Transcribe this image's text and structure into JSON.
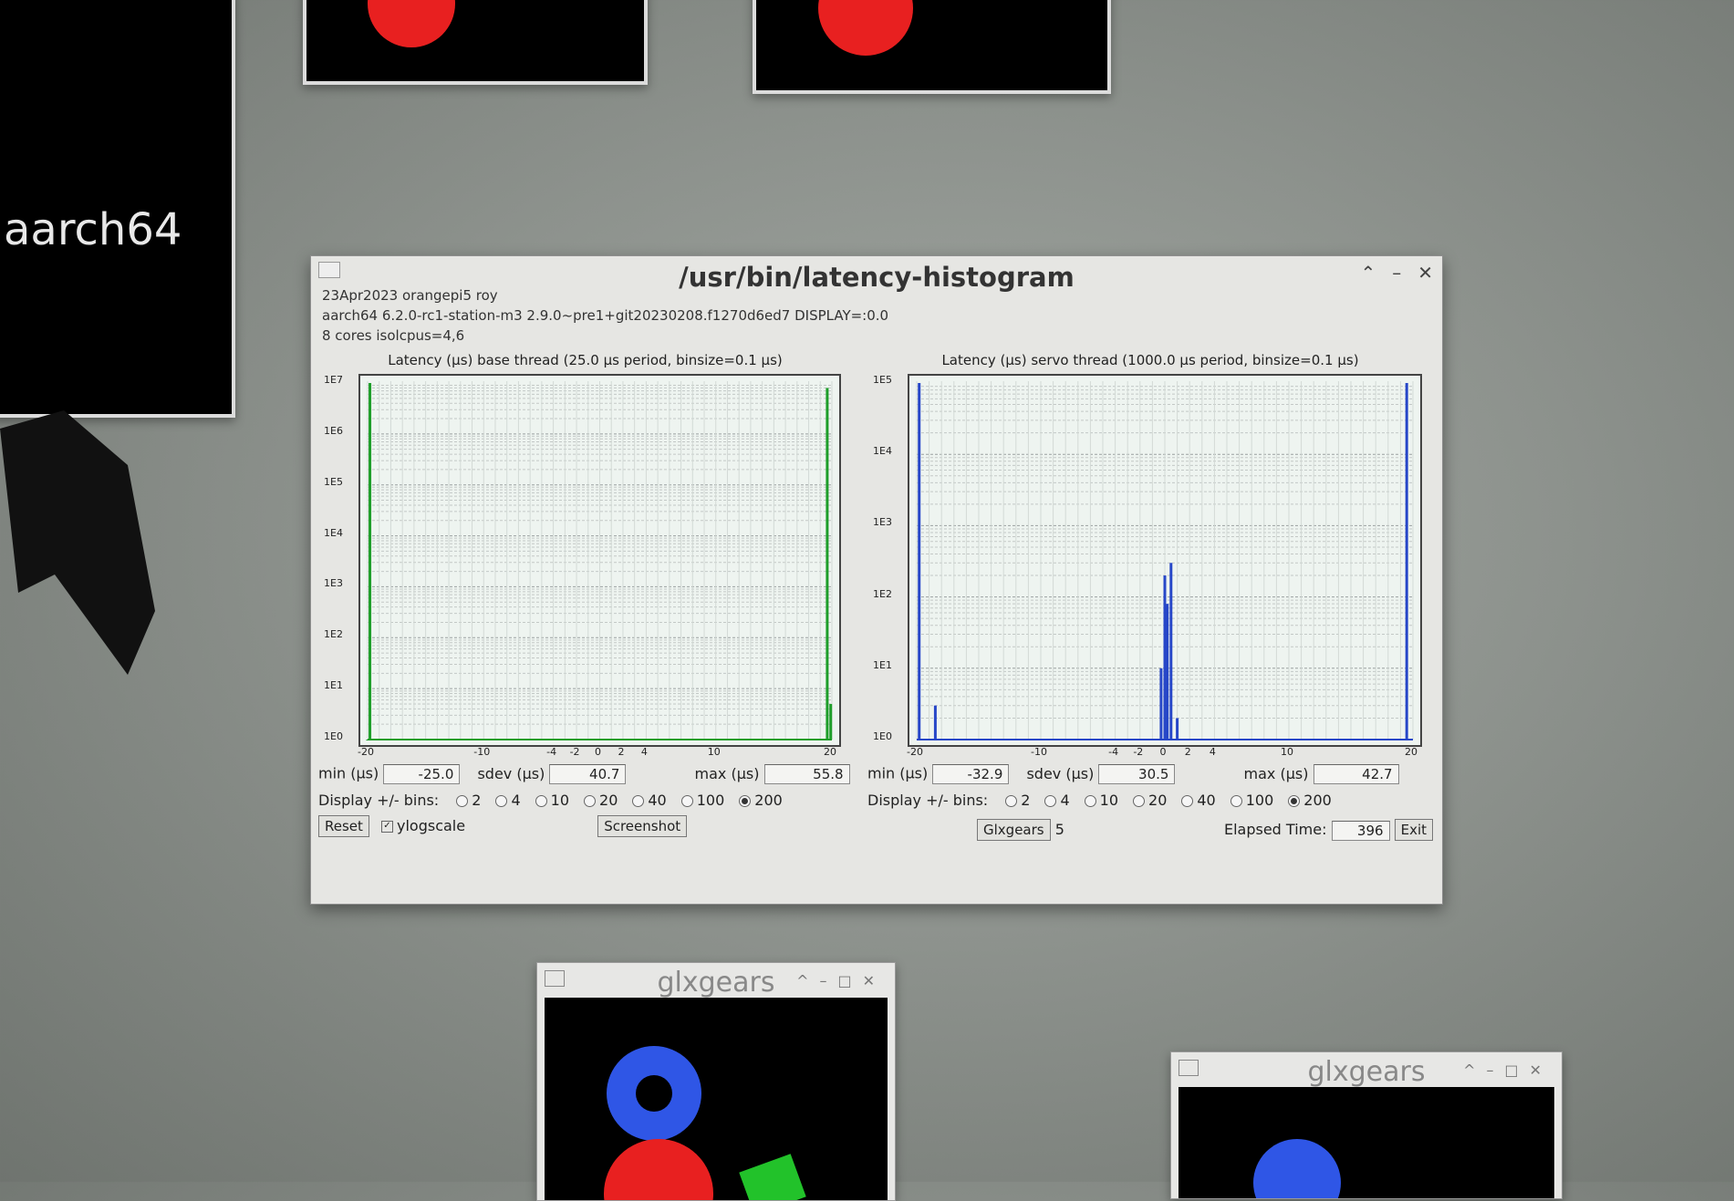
{
  "background_windows": {
    "terminal_text": "aarch64",
    "gear_window_title": "glxgears"
  },
  "window": {
    "title": "/usr/bin/latency-histogram",
    "info_line1": "23Apr2023 orangepi5 roy",
    "info_line2": "aarch64  6.2.0-rc1-station-m3  2.9.0~pre1+git20230208.f1270d6ed7  DISPLAY=:0.0",
    "info_line3": "8 cores  isolcpus=4,6"
  },
  "base_panel": {
    "title": "Latency (µs) base thread (25.0 µs period, binsize=0.1 µs)",
    "y_ticks": [
      "1E7",
      "1E6",
      "1E5",
      "1E4",
      "1E3",
      "1E2",
      "1E1",
      "1E0"
    ],
    "x_ticks": [
      "-20",
      "-10",
      "-4",
      "-2",
      "0",
      "2",
      "4",
      "10",
      "20"
    ],
    "min_label": "min (µs)",
    "min_value": "-25.0",
    "sdev_label": "sdev (µs)",
    "sdev_value": "40.7",
    "max_label": "max (µs)",
    "max_value": "55.8",
    "bins_label": "Display +/- bins:",
    "bins": [
      "2",
      "4",
      "10",
      "20",
      "40",
      "100",
      "200"
    ],
    "selected_bin": "200",
    "reset_label": "Reset",
    "ylogscale_label": "ylogscale",
    "screenshot_label": "Screenshot"
  },
  "servo_panel": {
    "title": "Latency (µs) servo thread (1000.0 µs period, binsize=0.1 µs)",
    "y_ticks": [
      "1E5",
      "1E4",
      "1E3",
      "1E2",
      "1E1",
      "1E0"
    ],
    "x_ticks": [
      "-20",
      "-10",
      "-4",
      "-2",
      "0",
      "2",
      "4",
      "10",
      "20"
    ],
    "min_label": "min (µs)",
    "min_value": "-32.9",
    "sdev_label": "sdev (µs)",
    "sdev_value": "30.5",
    "max_label": "max (µs)",
    "max_value": "42.7",
    "bins_label": "Display +/- bins:",
    "bins": [
      "2",
      "4",
      "10",
      "20",
      "40",
      "100",
      "200"
    ],
    "selected_bin": "200",
    "glxgears_label": "Glxgears",
    "glxgears_count": "5",
    "elapsed_label": "Elapsed Time:",
    "elapsed_value": "396",
    "exit_label": "Exit"
  },
  "chart_data": [
    {
      "type": "bar",
      "title": "Latency (µs) base thread (25.0 µs period, binsize=0.1 µs)",
      "xlabel": "",
      "ylabel": "",
      "xlim": [
        -20,
        20
      ],
      "yscale": "log",
      "ylim": [
        1,
        10000000
      ],
      "color": "#1e9e2a",
      "x": [
        -20,
        -19.8,
        19.6,
        19.9
      ],
      "values": [
        1,
        10000000,
        8000000,
        5
      ]
    },
    {
      "type": "bar",
      "title": "Latency (µs) servo thread (1000.0 µs period, binsize=0.1 µs)",
      "xlabel": "",
      "ylabel": "",
      "xlim": [
        -20,
        20
      ],
      "yscale": "log",
      "ylim": [
        1,
        100000
      ],
      "color": "#2747c8",
      "x": [
        -19.8,
        -18.5,
        -0.3,
        0.0,
        0.2,
        0.5,
        1.0,
        19.5
      ],
      "values": [
        100000,
        3,
        10,
        200,
        80,
        300,
        2,
        100000
      ]
    }
  ]
}
